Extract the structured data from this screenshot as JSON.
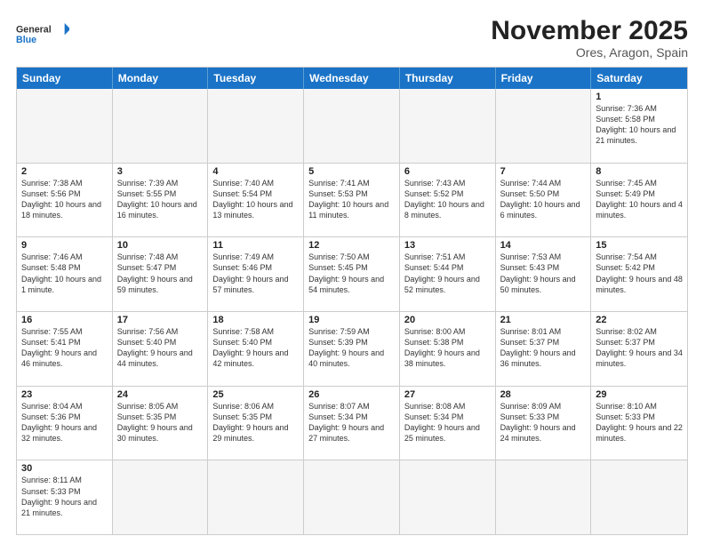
{
  "header": {
    "logo_general": "General",
    "logo_blue": "Blue",
    "month_title": "November 2025",
    "location": "Ores, Aragon, Spain"
  },
  "days_of_week": [
    "Sunday",
    "Monday",
    "Tuesday",
    "Wednesday",
    "Thursday",
    "Friday",
    "Saturday"
  ],
  "weeks": [
    [
      {
        "day": "",
        "empty": true,
        "text": ""
      },
      {
        "day": "",
        "empty": true,
        "text": ""
      },
      {
        "day": "",
        "empty": true,
        "text": ""
      },
      {
        "day": "",
        "empty": true,
        "text": ""
      },
      {
        "day": "",
        "empty": true,
        "text": ""
      },
      {
        "day": "",
        "empty": true,
        "text": ""
      },
      {
        "day": "1",
        "empty": false,
        "text": "Sunrise: 7:36 AM\nSunset: 5:58 PM\nDaylight: 10 hours and 21 minutes."
      }
    ],
    [
      {
        "day": "2",
        "empty": false,
        "text": "Sunrise: 7:38 AM\nSunset: 5:56 PM\nDaylight: 10 hours and 18 minutes."
      },
      {
        "day": "3",
        "empty": false,
        "text": "Sunrise: 7:39 AM\nSunset: 5:55 PM\nDaylight: 10 hours and 16 minutes."
      },
      {
        "day": "4",
        "empty": false,
        "text": "Sunrise: 7:40 AM\nSunset: 5:54 PM\nDaylight: 10 hours and 13 minutes."
      },
      {
        "day": "5",
        "empty": false,
        "text": "Sunrise: 7:41 AM\nSunset: 5:53 PM\nDaylight: 10 hours and 11 minutes."
      },
      {
        "day": "6",
        "empty": false,
        "text": "Sunrise: 7:43 AM\nSunset: 5:52 PM\nDaylight: 10 hours and 8 minutes."
      },
      {
        "day": "7",
        "empty": false,
        "text": "Sunrise: 7:44 AM\nSunset: 5:50 PM\nDaylight: 10 hours and 6 minutes."
      },
      {
        "day": "8",
        "empty": false,
        "text": "Sunrise: 7:45 AM\nSunset: 5:49 PM\nDaylight: 10 hours and 4 minutes."
      }
    ],
    [
      {
        "day": "9",
        "empty": false,
        "text": "Sunrise: 7:46 AM\nSunset: 5:48 PM\nDaylight: 10 hours and 1 minute."
      },
      {
        "day": "10",
        "empty": false,
        "text": "Sunrise: 7:48 AM\nSunset: 5:47 PM\nDaylight: 9 hours and 59 minutes."
      },
      {
        "day": "11",
        "empty": false,
        "text": "Sunrise: 7:49 AM\nSunset: 5:46 PM\nDaylight: 9 hours and 57 minutes."
      },
      {
        "day": "12",
        "empty": false,
        "text": "Sunrise: 7:50 AM\nSunset: 5:45 PM\nDaylight: 9 hours and 54 minutes."
      },
      {
        "day": "13",
        "empty": false,
        "text": "Sunrise: 7:51 AM\nSunset: 5:44 PM\nDaylight: 9 hours and 52 minutes."
      },
      {
        "day": "14",
        "empty": false,
        "text": "Sunrise: 7:53 AM\nSunset: 5:43 PM\nDaylight: 9 hours and 50 minutes."
      },
      {
        "day": "15",
        "empty": false,
        "text": "Sunrise: 7:54 AM\nSunset: 5:42 PM\nDaylight: 9 hours and 48 minutes."
      }
    ],
    [
      {
        "day": "16",
        "empty": false,
        "text": "Sunrise: 7:55 AM\nSunset: 5:41 PM\nDaylight: 9 hours and 46 minutes."
      },
      {
        "day": "17",
        "empty": false,
        "text": "Sunrise: 7:56 AM\nSunset: 5:40 PM\nDaylight: 9 hours and 44 minutes."
      },
      {
        "day": "18",
        "empty": false,
        "text": "Sunrise: 7:58 AM\nSunset: 5:40 PM\nDaylight: 9 hours and 42 minutes."
      },
      {
        "day": "19",
        "empty": false,
        "text": "Sunrise: 7:59 AM\nSunset: 5:39 PM\nDaylight: 9 hours and 40 minutes."
      },
      {
        "day": "20",
        "empty": false,
        "text": "Sunrise: 8:00 AM\nSunset: 5:38 PM\nDaylight: 9 hours and 38 minutes."
      },
      {
        "day": "21",
        "empty": false,
        "text": "Sunrise: 8:01 AM\nSunset: 5:37 PM\nDaylight: 9 hours and 36 minutes."
      },
      {
        "day": "22",
        "empty": false,
        "text": "Sunrise: 8:02 AM\nSunset: 5:37 PM\nDaylight: 9 hours and 34 minutes."
      }
    ],
    [
      {
        "day": "23",
        "empty": false,
        "text": "Sunrise: 8:04 AM\nSunset: 5:36 PM\nDaylight: 9 hours and 32 minutes."
      },
      {
        "day": "24",
        "empty": false,
        "text": "Sunrise: 8:05 AM\nSunset: 5:35 PM\nDaylight: 9 hours and 30 minutes."
      },
      {
        "day": "25",
        "empty": false,
        "text": "Sunrise: 8:06 AM\nSunset: 5:35 PM\nDaylight: 9 hours and 29 minutes."
      },
      {
        "day": "26",
        "empty": false,
        "text": "Sunrise: 8:07 AM\nSunset: 5:34 PM\nDaylight: 9 hours and 27 minutes."
      },
      {
        "day": "27",
        "empty": false,
        "text": "Sunrise: 8:08 AM\nSunset: 5:34 PM\nDaylight: 9 hours and 25 minutes."
      },
      {
        "day": "28",
        "empty": false,
        "text": "Sunrise: 8:09 AM\nSunset: 5:33 PM\nDaylight: 9 hours and 24 minutes."
      },
      {
        "day": "29",
        "empty": false,
        "text": "Sunrise: 8:10 AM\nSunset: 5:33 PM\nDaylight: 9 hours and 22 minutes."
      }
    ],
    [
      {
        "day": "30",
        "empty": false,
        "text": "Sunrise: 8:11 AM\nSunset: 5:33 PM\nDaylight: 9 hours and 21 minutes."
      },
      {
        "day": "",
        "empty": true,
        "text": ""
      },
      {
        "day": "",
        "empty": true,
        "text": ""
      },
      {
        "day": "",
        "empty": true,
        "text": ""
      },
      {
        "day": "",
        "empty": true,
        "text": ""
      },
      {
        "day": "",
        "empty": true,
        "text": ""
      },
      {
        "day": "",
        "empty": true,
        "text": ""
      }
    ]
  ]
}
